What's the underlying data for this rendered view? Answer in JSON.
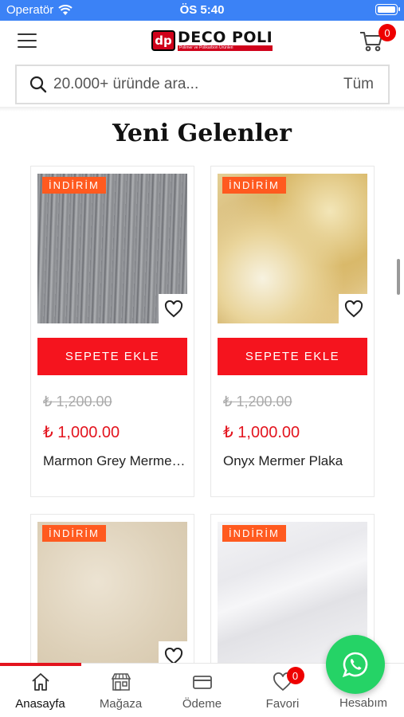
{
  "status_bar": {
    "carrier": "Operatör",
    "time": "ÖS 5:40"
  },
  "header": {
    "logo_mark": "dp",
    "logo_name": "DECO POLI",
    "logo_tagline": "Polimer ve Polikarbon Ürünleri",
    "cart_count": "0"
  },
  "search": {
    "placeholder": "20.000+ üründe ara...",
    "category": "Tüm"
  },
  "section": {
    "title": "Yeni Gelenler"
  },
  "products": [
    {
      "badge": "İNDİRİM",
      "add_label": "SEPETE EKLE",
      "old_price": "₺ 1,200.00",
      "price": "₺ 1,000.00",
      "title": "Marmon Grey Mermer Plaka",
      "texture": "grey-marble"
    },
    {
      "badge": "İNDİRİM",
      "add_label": "SEPETE EKLE",
      "old_price": "₺ 1,200.00",
      "price": "₺ 1,000.00",
      "title": "Onyx Mermer Plaka",
      "texture": "onyx"
    },
    {
      "badge": "İNDİRİM",
      "texture": "beige-marble"
    },
    {
      "badge": "İNDİRİM",
      "texture": "white-marble"
    }
  ],
  "tabbar": {
    "tabs": [
      {
        "label": "Anasayfa",
        "icon": "home-icon",
        "active": true
      },
      {
        "label": "Mağaza",
        "icon": "store-icon"
      },
      {
        "label": "Ödeme",
        "icon": "credit-card-icon"
      },
      {
        "label": "Favori",
        "icon": "heart-icon",
        "badge": "0"
      },
      {
        "label": "Hesabım",
        "icon": "user-icon"
      }
    ]
  },
  "colors": {
    "accent_red": "#f5141e",
    "sale_orange": "#ff5a1f",
    "status_blue": "#3b82f6",
    "whatsapp_green": "#25d366"
  }
}
